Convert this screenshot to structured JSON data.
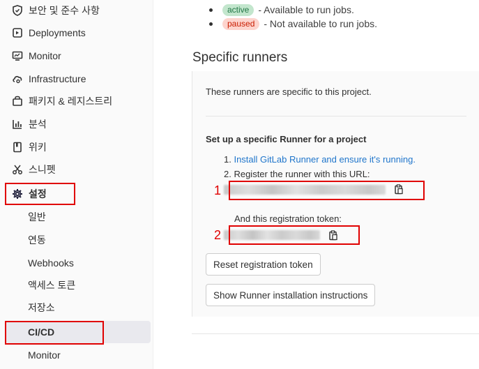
{
  "sidebar": {
    "items": [
      {
        "label": "보안 및 준수 사항",
        "icon": "shield-icon"
      },
      {
        "label": "Deployments",
        "icon": "deployments-icon"
      },
      {
        "label": "Monitor",
        "icon": "monitor-icon"
      },
      {
        "label": "Infrastructure",
        "icon": "cloud-gear-icon"
      },
      {
        "label": "패키지 & 레지스트리",
        "icon": "package-icon"
      },
      {
        "label": "분석",
        "icon": "chart-icon"
      },
      {
        "label": "위키",
        "icon": "book-icon"
      },
      {
        "label": "스니펫",
        "icon": "scissors-icon"
      },
      {
        "label": "설정",
        "icon": "gear-icon"
      }
    ],
    "sub_items": [
      {
        "label": "일반"
      },
      {
        "label": "연동"
      },
      {
        "label": "Webhooks"
      },
      {
        "label": "액세스 토큰"
      },
      {
        "label": "저장소"
      },
      {
        "label": "CI/CD"
      },
      {
        "label": "Monitor"
      }
    ]
  },
  "legend": {
    "active_badge": "active",
    "active_text": "- Available to run jobs.",
    "paused_badge": "paused",
    "paused_text": "- Not available to run jobs."
  },
  "main": {
    "section_title": "Specific runners",
    "intro": "These runners are specific to this project.",
    "setup_title": "Set up a specific Runner for a project",
    "step1_prefix": "1. ",
    "step1_link": "Install GitLab Runner and ensure it's running.",
    "step2": "2. Register the runner with this URL:",
    "token_label": "And this registration token:",
    "reset_button": "Reset registration token",
    "instructions_button": "Show Runner installation instructions"
  },
  "annotations": {
    "num1": "1",
    "num2": "2",
    "color": "#e00000"
  },
  "colors": {
    "link": "#1f75cb",
    "active_bg": "#c3e6cd",
    "paused_bg": "#fdd4cd"
  }
}
